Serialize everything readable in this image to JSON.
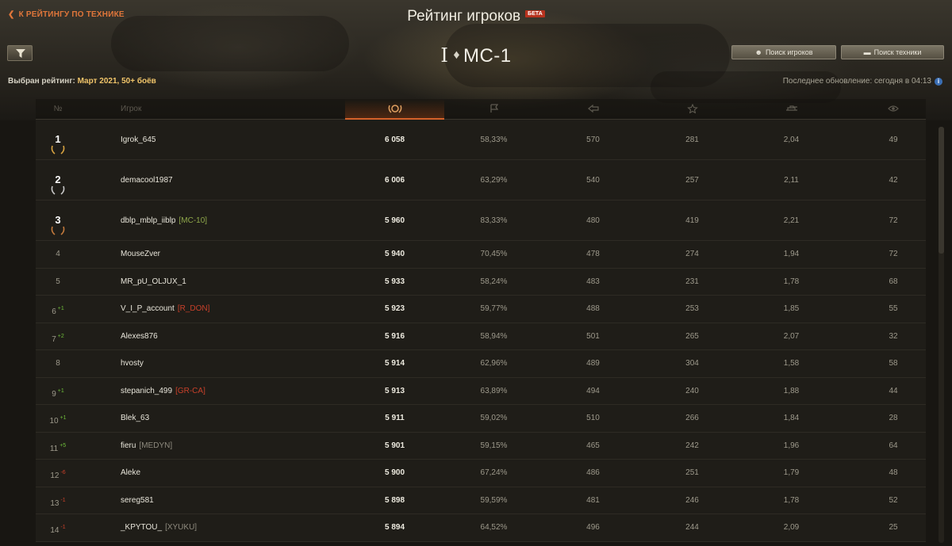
{
  "header": {
    "back_link": "К РЕЙТИНГУ ПО ТЕХНИКЕ",
    "title": "Рейтинг игроков",
    "beta_badge": "БЕТА",
    "vehicle_tier": "I",
    "vehicle_name": "МС-1",
    "search_players": "Поиск игроков",
    "search_vehicles": "Поиск техники",
    "rating_label": "Выбран рейтинг:",
    "rating_value": "Март 2021, 50+ боёв",
    "last_update": "Последнее обновление: сегодня в 04:13"
  },
  "columns": {
    "rank": "№",
    "player": "Игрок"
  },
  "colors": {
    "accent": "#e0763a",
    "gold": "#f1c56a",
    "delta_up": "#6fbf3a",
    "delta_down": "#c8402a",
    "clan_green": "#8fa84a",
    "clan_red": "#c8402a",
    "clan_gray": "#8e8a7e"
  },
  "rows": [
    {
      "rank": "1",
      "delta": "",
      "delta_dir": "",
      "name": "Igrok_645",
      "clan": "",
      "clan_color": "",
      "score": "6 058",
      "winrate": "58,33%",
      "b": "570",
      "e": "281",
      "f": "2,04",
      "g": "49",
      "medal": "gold"
    },
    {
      "rank": "2",
      "delta": "",
      "delta_dir": "",
      "name": "demacool1987",
      "clan": "",
      "clan_color": "",
      "score": "6 006",
      "winrate": "63,29%",
      "b": "540",
      "e": "257",
      "f": "2,11",
      "g": "42",
      "medal": "silver"
    },
    {
      "rank": "3",
      "delta": "",
      "delta_dir": "",
      "name": "dblp_mblp_iiblp",
      "clan": "[MC-10]",
      "clan_color": "green",
      "score": "5 960",
      "winrate": "83,33%",
      "b": "480",
      "e": "419",
      "f": "2,21",
      "g": "72",
      "medal": "bronze"
    },
    {
      "rank": "4",
      "delta": "",
      "delta_dir": "",
      "name": "MouseZver",
      "clan": "",
      "clan_color": "",
      "score": "5 940",
      "winrate": "70,45%",
      "b": "478",
      "e": "274",
      "f": "1,94",
      "g": "72",
      "medal": ""
    },
    {
      "rank": "5",
      "delta": "",
      "delta_dir": "",
      "name": "MR_pU_OLJUX_1",
      "clan": "",
      "clan_color": "",
      "score": "5 933",
      "winrate": "58,24%",
      "b": "483",
      "e": "231",
      "f": "1,78",
      "g": "68",
      "medal": ""
    },
    {
      "rank": "6",
      "delta": "+1",
      "delta_dir": "up",
      "name": "V_I_P_account",
      "clan": "[R_DON]",
      "clan_color": "red",
      "score": "5 923",
      "winrate": "59,77%",
      "b": "488",
      "e": "253",
      "f": "1,85",
      "g": "55",
      "medal": ""
    },
    {
      "rank": "7",
      "delta": "+2",
      "delta_dir": "up",
      "name": "Alexes876",
      "clan": "",
      "clan_color": "",
      "score": "5 916",
      "winrate": "58,94%",
      "b": "501",
      "e": "265",
      "f": "2,07",
      "g": "32",
      "medal": ""
    },
    {
      "rank": "8",
      "delta": "",
      "delta_dir": "",
      "name": "hvosty",
      "clan": "",
      "clan_color": "",
      "score": "5 914",
      "winrate": "62,96%",
      "b": "489",
      "e": "304",
      "f": "1,58",
      "g": "58",
      "medal": ""
    },
    {
      "rank": "9",
      "delta": "+1",
      "delta_dir": "up",
      "name": "stepanich_499",
      "clan": "[GR-CA]",
      "clan_color": "red",
      "score": "5 913",
      "winrate": "63,89%",
      "b": "494",
      "e": "240",
      "f": "1,88",
      "g": "44",
      "medal": ""
    },
    {
      "rank": "10",
      "delta": "+1",
      "delta_dir": "up",
      "name": "Blek_63",
      "clan": "",
      "clan_color": "",
      "score": "5 911",
      "winrate": "59,02%",
      "b": "510",
      "e": "266",
      "f": "1,84",
      "g": "28",
      "medal": ""
    },
    {
      "rank": "11",
      "delta": "+5",
      "delta_dir": "up",
      "name": "fieru",
      "clan": "[MEDYN]",
      "clan_color": "gray",
      "score": "5 901",
      "winrate": "59,15%",
      "b": "465",
      "e": "242",
      "f": "1,96",
      "g": "64",
      "medal": ""
    },
    {
      "rank": "12",
      "delta": "-6",
      "delta_dir": "down",
      "name": "Aleke",
      "clan": "",
      "clan_color": "",
      "score": "5 900",
      "winrate": "67,24%",
      "b": "486",
      "e": "251",
      "f": "1,79",
      "g": "48",
      "medal": ""
    },
    {
      "rank": "13",
      "delta": "-1",
      "delta_dir": "down",
      "name": "sereg581",
      "clan": "",
      "clan_color": "",
      "score": "5 898",
      "winrate": "59,59%",
      "b": "481",
      "e": "246",
      "f": "1,78",
      "g": "52",
      "medal": ""
    },
    {
      "rank": "14",
      "delta": "-1",
      "delta_dir": "down",
      "name": "_KPYTOU_",
      "clan": "[XYUKU]",
      "clan_color": "gray",
      "score": "5 894",
      "winrate": "64,52%",
      "b": "496",
      "e": "244",
      "f": "2,09",
      "g": "25",
      "medal": ""
    }
  ]
}
